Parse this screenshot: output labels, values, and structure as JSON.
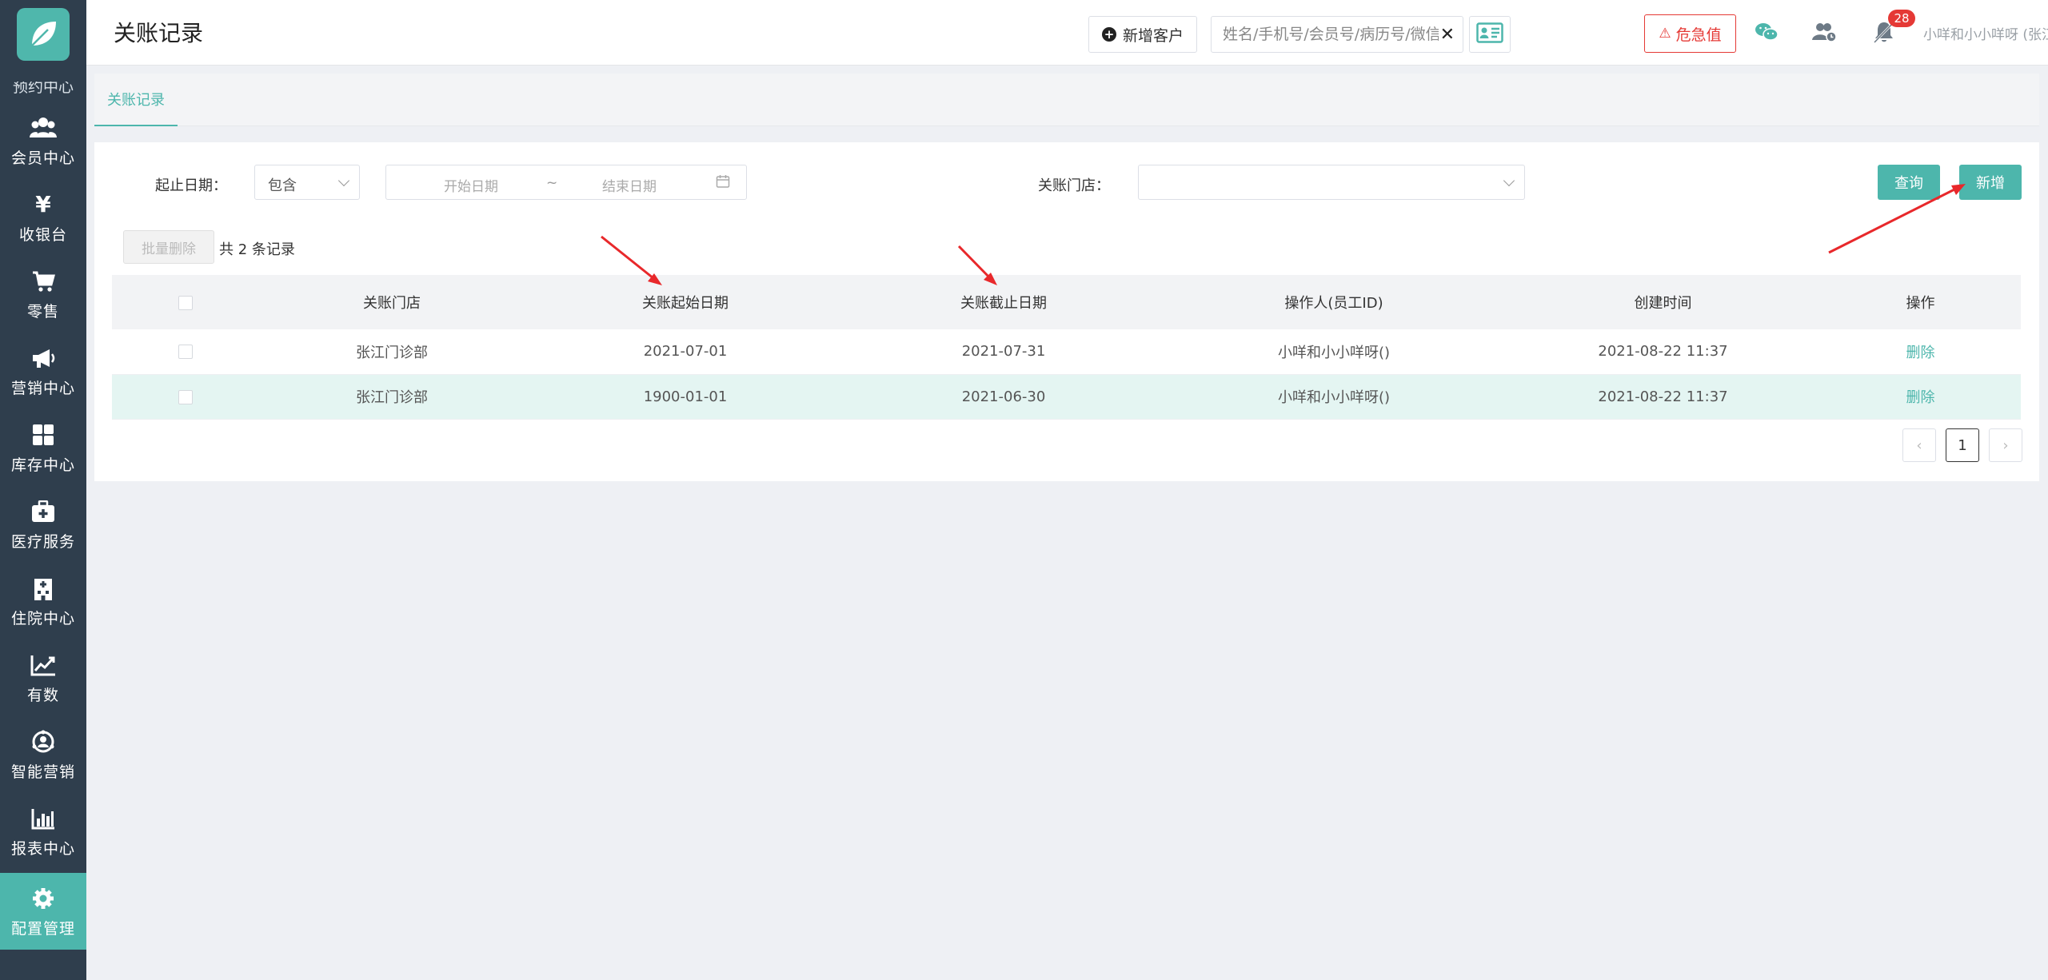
{
  "header": {
    "title": "关账记录",
    "new_customer_label": "新增客户",
    "search_placeholder": "姓名/手机号/会员号/病历号/微信号",
    "critical_label": "危急值",
    "notification_count": "28",
    "user": "小咩和小小咩呀 (张江门诊部)"
  },
  "sidebar": {
    "items": [
      {
        "label": "会员中心",
        "icon": "members-icon"
      },
      {
        "label": "收银台",
        "icon": "yen-icon"
      },
      {
        "label": "零售",
        "icon": "cart-icon"
      },
      {
        "label": "营销中心",
        "icon": "megaphone-icon"
      },
      {
        "label": "库存中心",
        "icon": "grid-icon"
      },
      {
        "label": "医疗服务",
        "icon": "medical-kit-icon"
      },
      {
        "label": "住院中心",
        "icon": "hospital-icon"
      },
      {
        "label": "有数",
        "icon": "trend-icon"
      },
      {
        "label": "智能营销",
        "icon": "smart-icon"
      },
      {
        "label": "报表中心",
        "icon": "bar-chart-icon"
      },
      {
        "label": "配置管理",
        "icon": "gear-icon"
      }
    ]
  },
  "tabs": {
    "active": "关账记录"
  },
  "filters": {
    "date_label": "起止日期：",
    "contain_value": "包含",
    "start_placeholder": "开始日期",
    "tilde": "~",
    "end_placeholder": "结束日期",
    "store_label": "关账门店："
  },
  "actions": {
    "query": "查询",
    "add": "新增",
    "batch_delete": "批量删除",
    "count_text": "共 2 条记录"
  },
  "table": {
    "columns": [
      "关账门店",
      "关账起始日期",
      "关账截止日期",
      "操作人(员工ID)",
      "创建时间",
      "操作"
    ],
    "rows": [
      {
        "store": "张江门诊部",
        "start": "2021-07-01",
        "end": "2021-07-31",
        "operator": "小咩和小小咩呀()",
        "created": "2021-08-22 11:37",
        "action": "删除"
      },
      {
        "store": "张江门诊部",
        "start": "1900-01-01",
        "end": "2021-06-30",
        "operator": "小咩和小小咩呀()",
        "created": "2021-08-22 11:37",
        "action": "删除"
      }
    ]
  },
  "pagination": {
    "prev": "‹",
    "current": "1",
    "next": "›"
  },
  "colors": {
    "accent": "#4db6ac",
    "sidebar": "#2f3e4d",
    "danger": "#e53935"
  }
}
